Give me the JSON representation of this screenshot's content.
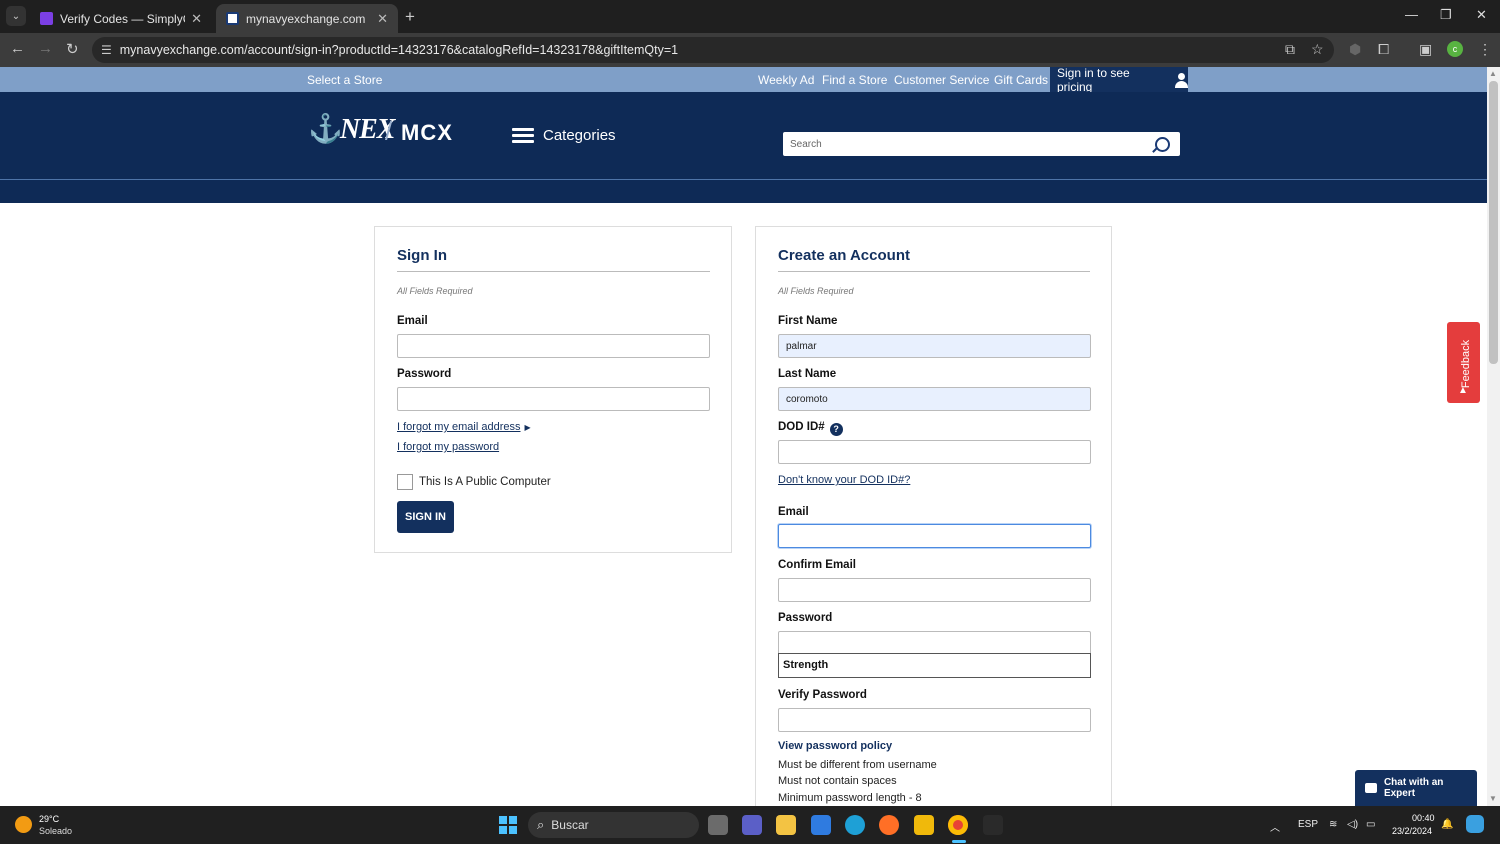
{
  "browser": {
    "tabs": [
      {
        "title": "Verify Codes — SimplyCodes",
        "active": false
      },
      {
        "title": "mynavyexchange.com",
        "active": true
      }
    ],
    "url": "mynavyexchange.com/account/sign-in?productId=14323176&catalogRefId=14323178&giftItemQty=1",
    "profile_initial": "c"
  },
  "site": {
    "topnav": {
      "select_store": "Select a Store",
      "weekly_ad": "Weekly Ad",
      "find_store": "Find a Store",
      "customer_service": "Customer Service",
      "gift_cards": "Gift Cards",
      "sign_in_pricing": "Sign in to see pricing"
    },
    "logo": {
      "nex": "NEX",
      "mcx": "MCX"
    },
    "categories_label": "Categories",
    "search_placeholder": "Search"
  },
  "signin": {
    "title": "Sign In",
    "required_note": "All Fields Required",
    "email_label": "Email",
    "email_value": "",
    "password_label": "Password",
    "forgot_email": "I forgot my email address",
    "forgot_password": "I forgot my password",
    "public_computer": "This Is A Public Computer",
    "submit": "SIGN IN"
  },
  "create": {
    "title": "Create an Account",
    "required_note": "All Fields Required",
    "first_name_label": "First Name",
    "first_name_value": "palmar",
    "last_name_label": "Last Name",
    "last_name_value": "coromoto",
    "dod_label": "DOD ID#",
    "dod_value": "",
    "dod_help": "Don't know your DOD ID#?",
    "email_label": "Email",
    "email_value": "",
    "confirm_email_label": "Confirm Email",
    "password_label": "Password",
    "strength_label": "Strength",
    "verify_password_label": "Verify Password",
    "policy_link": "View password policy",
    "policy_rules": [
      "Must be different from username",
      "Must not contain spaces",
      "Minimum password length - 8"
    ]
  },
  "widgets": {
    "feedback": "Feedback",
    "chat": "Chat with an Expert"
  },
  "taskbar": {
    "weather_temp": "29°C",
    "weather_desc": "Soleado",
    "search_label": "Buscar",
    "language": "ESP",
    "time": "00:40",
    "date": "23/2/2024"
  },
  "colors": {
    "brand_navy": "#13305e",
    "topnav_blue": "#7f9fc8",
    "feedback_red": "#e43d3d",
    "autofill_bg": "#e8f0fe"
  }
}
